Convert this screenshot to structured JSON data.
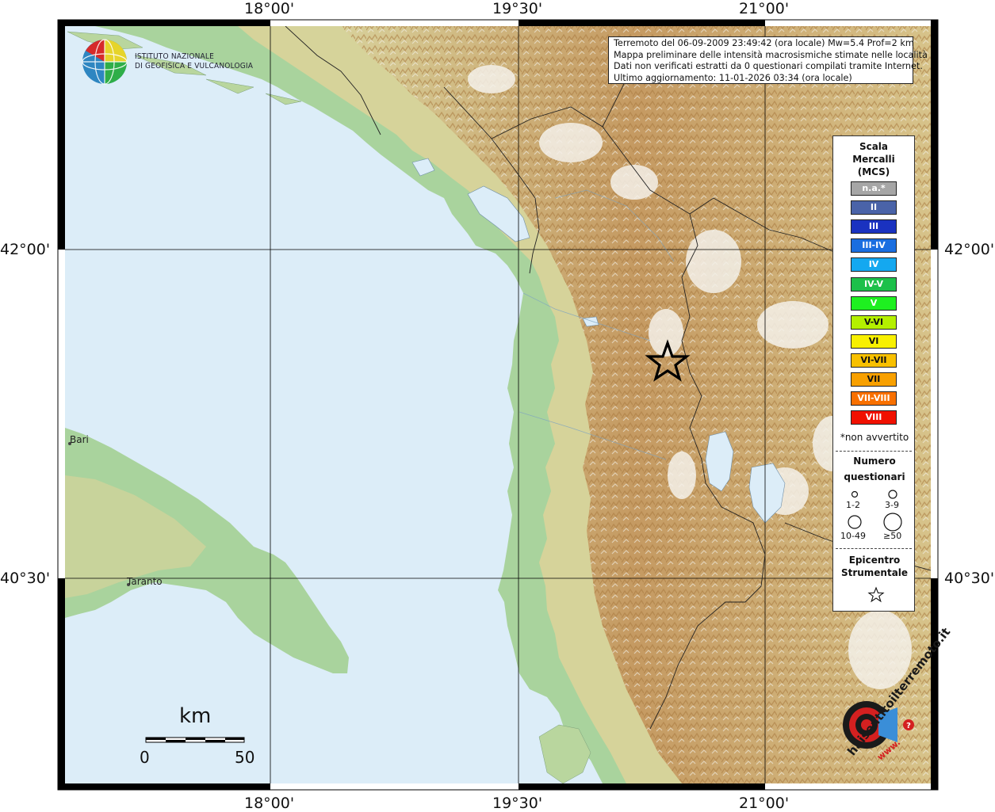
{
  "info": {
    "line1": "Terremoto del 06-09-2009 23:49:42 (ora locale) Mw=5.4 Prof=2 km",
    "line2": "Mappa preliminare delle intensità macrosismiche stimate nelle località",
    "line3": "Dati non verificati estratti da 0 questionari compilati tramite Internet.",
    "line4": "Ultimo aggiornamento: 11-01-2026 03:34 (ora locale)"
  },
  "axes": {
    "lon_top": [
      "18°00'",
      "19°30'",
      "21°00'"
    ],
    "lon_bottom": [
      "18°00'",
      "19°30'",
      "21°00'"
    ],
    "lat_left": [
      "42°00'",
      "40°30'"
    ],
    "lat_right": [
      "42°00'",
      "40°30'"
    ]
  },
  "institute": {
    "line1": "ISTITUTO NAZIONALE",
    "line2": "DI GEOFISICA E VULCANOLOGIA"
  },
  "cities": {
    "bari": "Bari",
    "taranto": "Taranto"
  },
  "scale_bar": {
    "unit": "km",
    "min": "0",
    "max": "50"
  },
  "legend": {
    "title1": "Scala",
    "title2": "Mercalli",
    "title3": "(MCS)",
    "classes": [
      {
        "label": "n.a.*",
        "color": "#a6a6a6"
      },
      {
        "label": "II",
        "color": "#4a63a8"
      },
      {
        "label": "III",
        "color": "#1a32c0"
      },
      {
        "label": "III-IV",
        "color": "#1a6ee0"
      },
      {
        "label": "IV",
        "color": "#14a8f0"
      },
      {
        "label": "IV-V",
        "color": "#1cc04a"
      },
      {
        "label": "V",
        "color": "#1ef020"
      },
      {
        "label": "V-VI",
        "color": "#b4f000"
      },
      {
        "label": "VI",
        "color": "#f8f000"
      },
      {
        "label": "VI-VII",
        "color": "#f8c000"
      },
      {
        "label": "VII",
        "color": "#f8a000"
      },
      {
        "label": "VII-VIII",
        "color": "#f87000"
      },
      {
        "label": "VIII",
        "color": "#f01000"
      }
    ],
    "not_felt_note": "*non avvertito",
    "questionnaires_title1": "Numero",
    "questionnaires_title2": "questionari",
    "q_labels": [
      "1-2",
      "3-9",
      "10-49",
      "≥50"
    ],
    "epicenter_title1": "Epicentro",
    "epicenter_title2": "Strumentale"
  },
  "haisentito": {
    "text": "haisentitoilterremoto.it",
    "prefix": "www."
  },
  "colors": {
    "sea": "#dcedf8",
    "lowland": "#a6d19e",
    "hill": "#d9d49a",
    "mountain": "#c9a26a",
    "peak": "#f2efe9"
  }
}
